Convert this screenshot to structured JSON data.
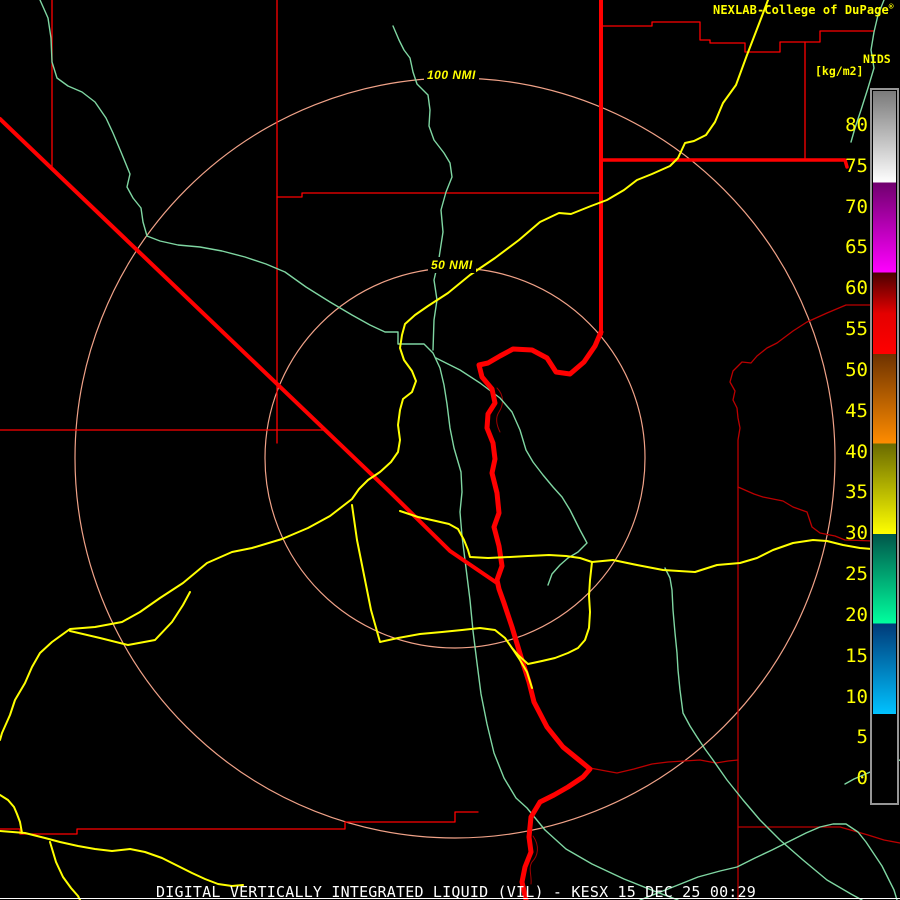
{
  "header": {
    "brand": "NEXLAB-College of DuPage",
    "brand_mark": "®"
  },
  "colorbar": {
    "title": "NIDS",
    "units": "[kg/m2]",
    "ticks": [
      "80",
      "75",
      "70",
      "65",
      "60",
      "55",
      "50",
      "45",
      "40",
      "35",
      "30",
      "25",
      "20",
      "15",
      "10",
      "5",
      "0"
    ],
    "scale_min": 0,
    "scale_max": 80,
    "segments": [
      {
        "from": 85,
        "to": 73,
        "color_top": "#7a7a7a",
        "color_bottom": "#ffffff",
        "name": "gray-white"
      },
      {
        "from": 73,
        "to": 62,
        "color_top": "#70006e",
        "color_bottom": "#ff00ff",
        "name": "purple-magenta"
      },
      {
        "from": 62,
        "to": 52,
        "color_top": "#4a0000",
        "color_bottom": "#ff0000",
        "name": "darkred-red"
      },
      {
        "from": 52,
        "to": 41,
        "color_top": "#6e3200",
        "color_bottom": "#ff8c00",
        "name": "brown-orange"
      },
      {
        "from": 41,
        "to": 30,
        "color_top": "#6a6a00",
        "color_bottom": "#ffff00",
        "name": "olive-yellow"
      },
      {
        "from": 30,
        "to": 19,
        "color_top": "#00564a",
        "color_bottom": "#00ff9e",
        "name": "teal-springgreen"
      },
      {
        "from": 19,
        "to": 8,
        "color_top": "#003a78",
        "color_bottom": "#00c2ff",
        "name": "navy-cyan"
      },
      {
        "from": 8,
        "to": 0,
        "color_top": "#000000",
        "color_bottom": "#000000",
        "name": "black"
      }
    ]
  },
  "map": {
    "rings": [
      {
        "label": "100 NMI",
        "radius_px": 380
      },
      {
        "label": "50 NMI",
        "radius_px": 190
      }
    ],
    "colors": {
      "background": "#000000",
      "range_ring": "#f0a288",
      "state_border": "#ff0000",
      "county_border": "#ff0000",
      "county_border_dark": "#bb0000",
      "river": "#7fd6a2",
      "road": "#ffff00"
    }
  },
  "footer": {
    "title": "DIGITAL VERTICALLY INTEGRATED LIQUID (VIL) - KESX 15 DEC 25 00:29"
  }
}
